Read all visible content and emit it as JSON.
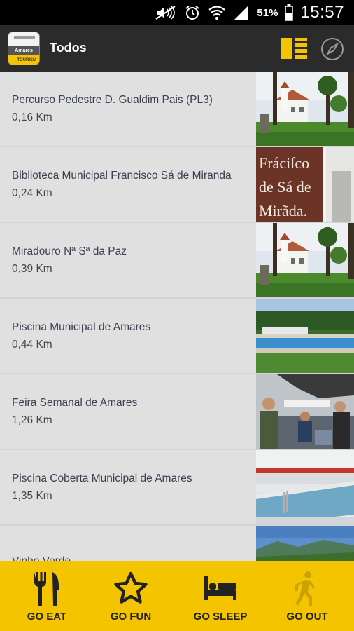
{
  "status_bar": {
    "icons": [
      "mute-icon",
      "alarm-icon",
      "wifi-icon",
      "signal-icon",
      "battery-icon"
    ],
    "battery_percent": "51%",
    "time": "15:57"
  },
  "app_bar": {
    "logo": {
      "label": "Amares",
      "sub": "TOURISM"
    },
    "title": "Todos",
    "actions": [
      "list-view-icon",
      "compass-icon"
    ],
    "accent_color": "#f5c400"
  },
  "list": {
    "items": [
      {
        "name": "Percurso Pedestre D. Gualdim Pais (PL3)",
        "distance": "0,16 Km",
        "image": "church-photo"
      },
      {
        "name": "Biblioteca Municipal Francisco Sá de Miranda",
        "distance": "0,24 Km",
        "image": "library-sign-photo",
        "sign_text": [
          "Fráciſco",
          "de Sá de",
          "Mirãda."
        ]
      },
      {
        "name": "Miradouro Nª Sª da Paz",
        "distance": "0,39 Km",
        "image": "church-photo"
      },
      {
        "name": "Piscina Municipal de Amares",
        "distance": "0,44 Km",
        "image": "pool-photo"
      },
      {
        "name": "Feira Semanal de Amares",
        "distance": "1,26 Km",
        "image": "market-photo"
      },
      {
        "name": "Piscina Coberta Municipal de Amares",
        "distance": "1,35 Km",
        "image": "indoor-pool-photo"
      },
      {
        "name": "Vinho Verde",
        "distance": "",
        "image": "vineyard-photo"
      }
    ]
  },
  "bottom_nav": {
    "items": [
      {
        "label": "GO EAT",
        "icon": "fork-knife-icon",
        "active": false
      },
      {
        "label": "GO FUN",
        "icon": "star-icon",
        "active": false
      },
      {
        "label": "GO SLEEP",
        "icon": "bed-icon",
        "active": false
      },
      {
        "label": "GO OUT",
        "icon": "walking-person-icon",
        "active": true
      }
    ]
  }
}
